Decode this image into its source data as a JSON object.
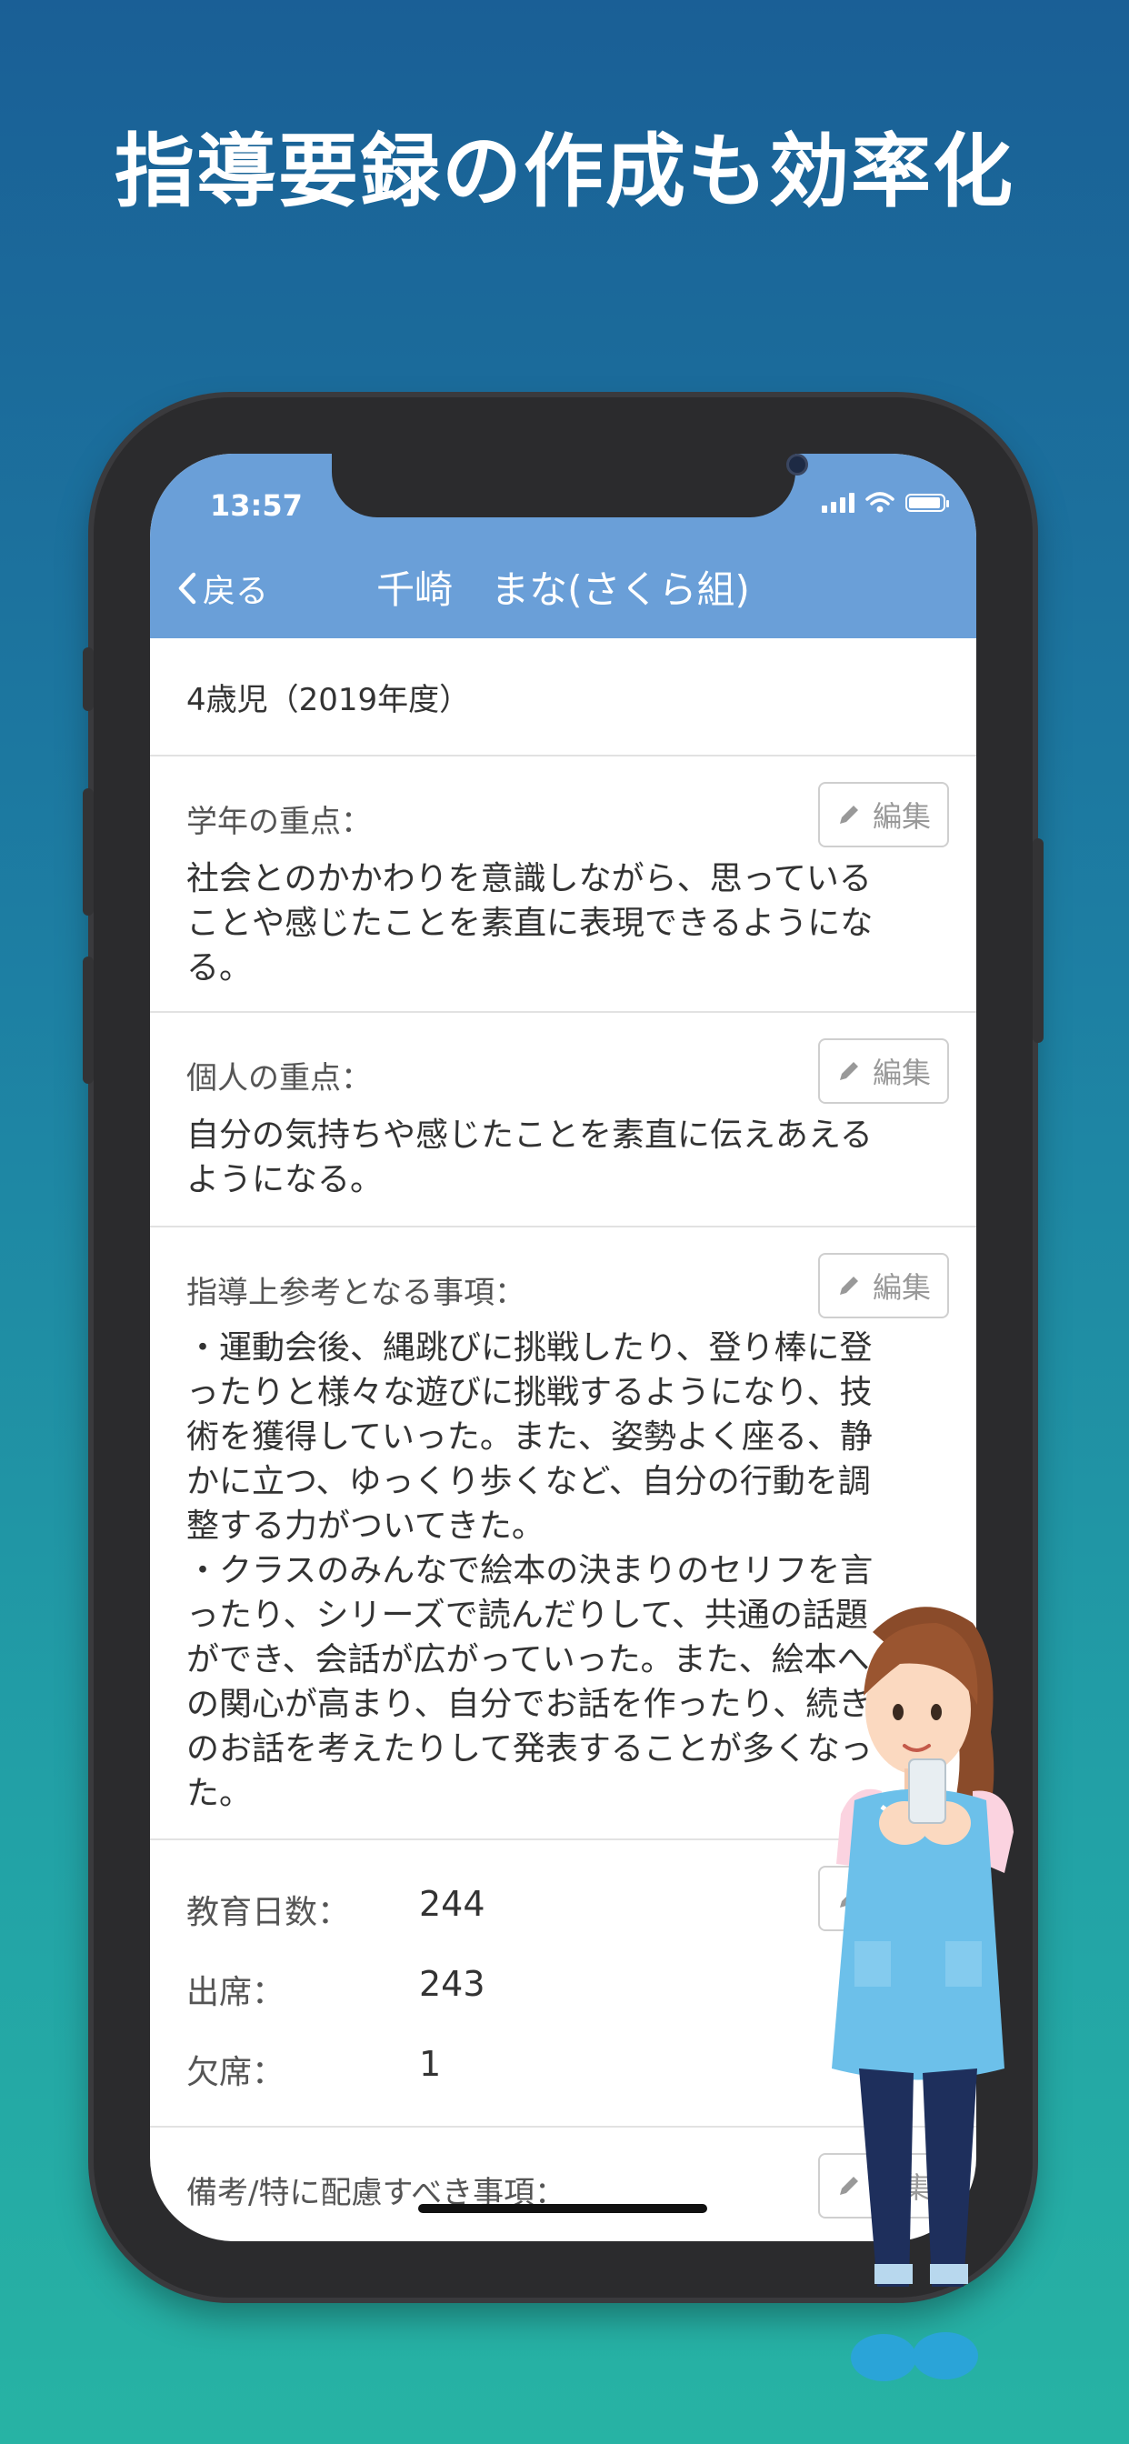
{
  "headline": "指導要録の作成も効率化",
  "status_bar": {
    "time": "13:57"
  },
  "nav": {
    "back_label": "戻る",
    "title": "千崎　まな(さくら組)"
  },
  "year_label": "4歳児（2019年度）",
  "edit_label": "編集",
  "sections": [
    {
      "label": "学年の重点：",
      "lines": [
        "社会とのかかわりを意識しながら、思っている",
        "ことや感じたことを素直に表現できるようにな",
        "る。"
      ]
    },
    {
      "label": "個人の重点：",
      "lines": [
        "自分の気持ちや感じたことを素直に伝えあえる",
        "ようになる。"
      ]
    },
    {
      "label": "指導上参考となる事項：",
      "lines": [
        "・運動会後、縄跳びに挑戦したり、登り棒に登",
        "ったりと様々な遊びに挑戦するようになり、技",
        "術を獲得していった。また、姿勢よく座る、静",
        "かに立つ、ゆっくり歩くなど、自分の行動を調",
        "整する力がついてきた。",
        "・クラスのみんなで絵本の決まりのセリフを言",
        "ったり、シリーズで読んだりして、共通の話題",
        "ができ、会話が広がっていった。また、絵本へ",
        "の関心が高まり、自分でお話を作ったり、続き",
        "のお話を考えたりして発表することが多くなっ",
        "た。"
      ]
    }
  ],
  "attendance": [
    {
      "label": "教育日数：",
      "value": "244"
    },
    {
      "label": "出席：",
      "value": "243"
    },
    {
      "label": "欠席：",
      "value": "1"
    }
  ],
  "notes_label": "備考/特に配慮すべき事項："
}
